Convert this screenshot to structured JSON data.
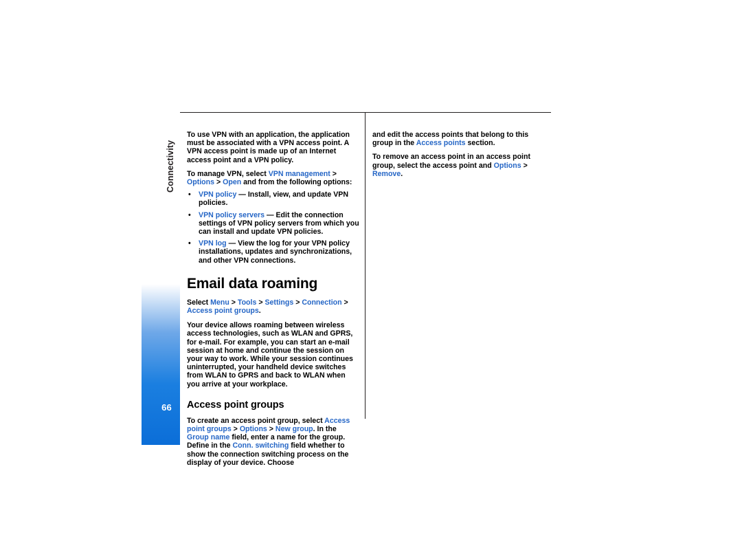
{
  "page": {
    "number": "66",
    "chapter": "Connectivity"
  },
  "left_column": {
    "para_vpn_intro": "To use VPN with an application, the application must be associated with a VPN access point. A VPN access point is made up of an Internet access point and a VPN policy.",
    "manage_vpn": {
      "pre": "To manage VPN, select ",
      "menu1": "VPN management",
      "sep1": " > ",
      "menu2": "Options",
      "sep2": " > ",
      "menu3": "Open",
      "post": " and from the following options:"
    },
    "bullets": [
      {
        "term": "VPN policy",
        "text": " — Install, view, and update VPN policies."
      },
      {
        "term": "VPN policy servers",
        "text": " — Edit the connection settings of VPN policy servers from which you can install and update VPN policies."
      },
      {
        "term": "VPN log",
        "text": " — View the log for your VPN policy installations, updates and synchronizations, and other VPN connections."
      }
    ],
    "heading": "Email data roaming",
    "select_path": {
      "pre": "Select ",
      "items": [
        "Menu",
        "Tools",
        "Settings",
        "Connection",
        "Access point groups"
      ],
      "separator": " > ",
      "post": "."
    },
    "para_roaming": "Your device allows roaming between wireless access technologies, such as WLAN and GPRS, for e-mail. For example, you can start an e-mail session at home and continue the session on your way to work. While your session continues uninterrupted, your handheld device switches from WLAN to GPRS and back to WLAN when you arrive at your workplace.",
    "subheading": "Access point groups",
    "create_group": {
      "seg1": "To create an access point group, select ",
      "link1": "Access point groups",
      "seg2": " > ",
      "link2": "Options",
      "seg3": " > ",
      "link3": "New group",
      "seg4": ". In the ",
      "link4": "Group name",
      "seg5": " field, enter a name for the group. Define in the ",
      "link5": "Conn. switching",
      "seg6": " field whether to show the connection switching process on the display of your device. Choose"
    }
  },
  "right_column": {
    "para_edit": {
      "seg1": "and edit the access points that belong to this group in the ",
      "link1": "Access points",
      "seg2": " section."
    },
    "para_remove": {
      "seg1": "To remove an access point in an access point group, select the access point and ",
      "link1": "Options",
      "seg2": " > ",
      "link2": "Remove",
      "seg3": "."
    }
  },
  "colors": {
    "link_blue": "#2566c6",
    "tab_blue": "#0b6ed8",
    "rule_black": "#231f20"
  }
}
